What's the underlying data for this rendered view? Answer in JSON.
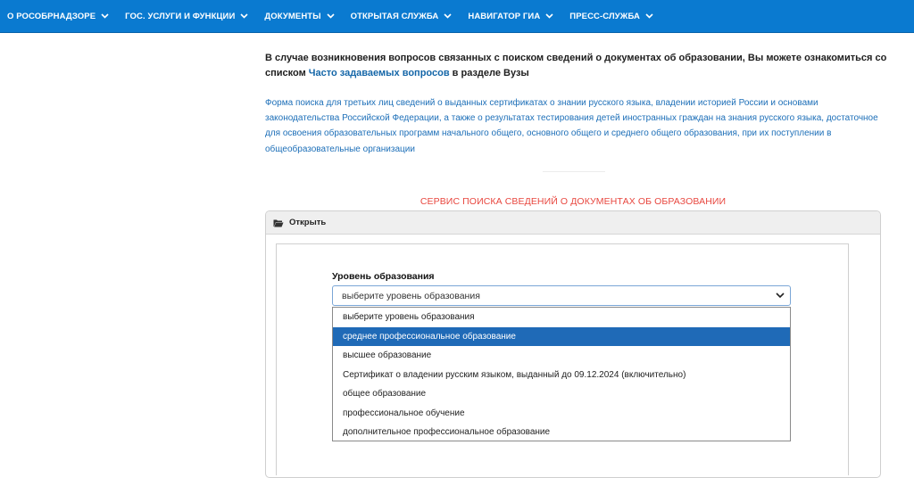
{
  "nav": {
    "items": [
      {
        "label": "О РОСОБРНАДЗОРЕ"
      },
      {
        "label": "ГОС. УСЛУГИ И ФУНКЦИИ"
      },
      {
        "label": "ДОКУМЕНТЫ"
      },
      {
        "label": "ОТКРЫТАЯ СЛУЖБА"
      },
      {
        "label": "НАВИГАТОР ГИА"
      },
      {
        "label": "ПРЕСС-СЛУЖБА"
      }
    ]
  },
  "intro": {
    "text_before": "В случае возникновения вопросов связанных с поиском сведений о документах об образовании, Вы можете ознакомиться со списком ",
    "link": "Часто задаваемых вопросов",
    "text_after": " в разделе Вузы"
  },
  "info_text": "Форма поиска для третьих лиц сведений о выданных сертификатах о знании русского языка, владении историей России и основами законодательства Российской Федерации, а также о результатах тестирования детей иностранных граждан на знания русского языка, достаточное для освоения образовательных программ начального общего, основного общего и среднего общего образования, при их поступлении в общеобразовательные организации",
  "service_title": "СЕРВИС ПОИСКА СВЕДЕНИЙ О ДОКУМЕНТАХ ОБ ОБРАЗОВАНИИ",
  "panel": {
    "header_label": "Открыть"
  },
  "form": {
    "level_label": "Уровень образования",
    "select_value": "выберите уровень образования",
    "options": [
      {
        "label": "выберите уровень образования"
      },
      {
        "label": "среднее профессиональное образование"
      },
      {
        "label": "высшее образование"
      },
      {
        "label": "Сертификат о владении русским языком, выданный до 09.12.2024 (включительно)"
      },
      {
        "label": "общее образование"
      },
      {
        "label": "профессиональное обучение"
      },
      {
        "label": "дополнительное профессиональное образование"
      }
    ],
    "highlighted_option_index": 1
  },
  "colors": {
    "nav_bg": "#0a7ad0",
    "link": "#1466a8",
    "info_text": "#1d6fb8",
    "service_title": "#e8473f",
    "selected_option": "#1f6ab7"
  }
}
